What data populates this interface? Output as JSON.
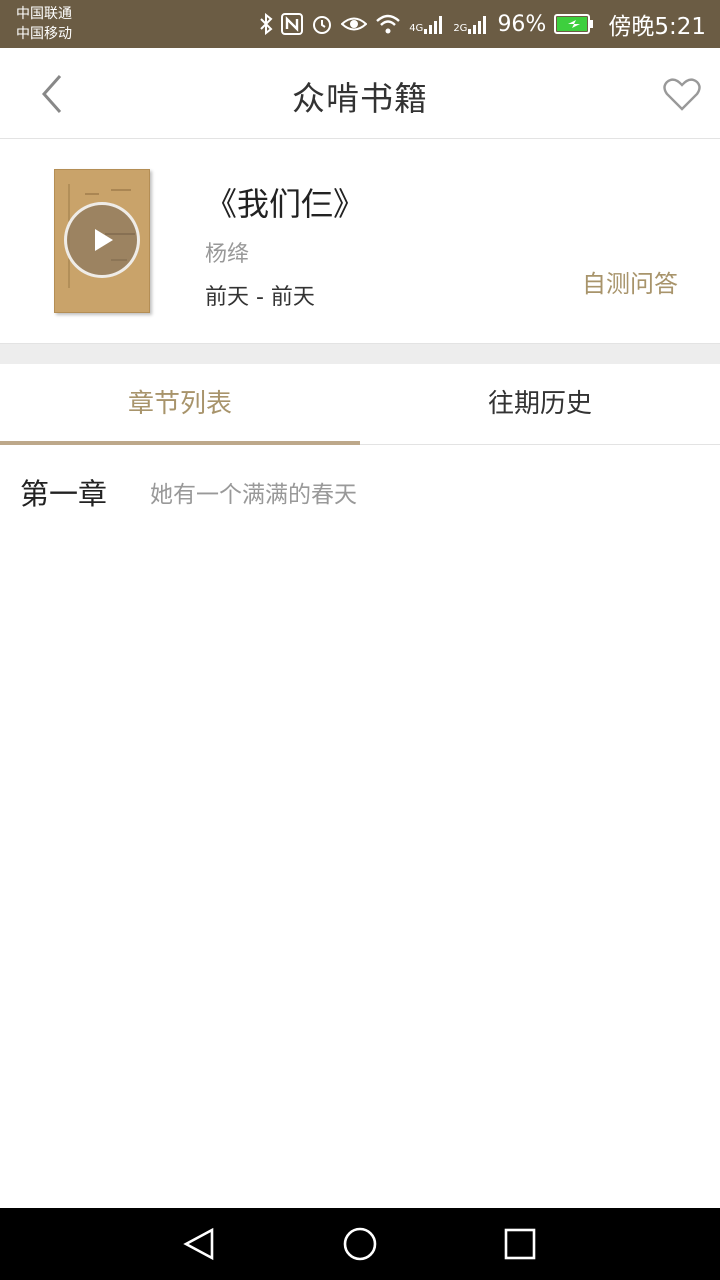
{
  "status_bar": {
    "carrier_1": "中国联通",
    "carrier_2": "中国移动",
    "network_1": "4G",
    "network_2": "2G",
    "battery": "96%",
    "time": "傍晚5:21",
    "icons": [
      "bluetooth-icon",
      "nfc-icon",
      "alarm-icon",
      "eye-comfort-icon",
      "wifi-icon",
      "signal-icon",
      "battery-icon"
    ]
  },
  "header": {
    "title": "众啃书籍",
    "back_icon": "chevron-left-icon",
    "favorite_icon": "heart-outline-icon"
  },
  "book": {
    "title": "《我们仨》",
    "author": "杨绛",
    "dates": "前天 - 前天",
    "quiz_label": "自测问答"
  },
  "tabs": [
    {
      "label": "章节列表",
      "active": true
    },
    {
      "label": "往期历史",
      "active": false
    }
  ],
  "chapters": [
    {
      "number": "第一章",
      "title": "她有一个满满的春天"
    }
  ],
  "colors": {
    "status_bar_bg": "#6b5c44",
    "accent": "#a8946b",
    "divider": "#e3e3e3"
  }
}
